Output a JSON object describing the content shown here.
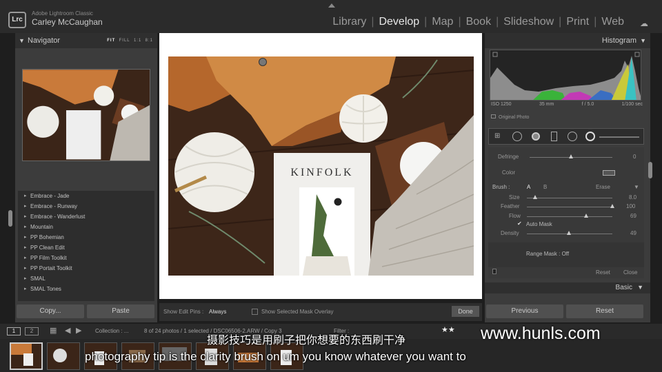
{
  "app": {
    "product": "Adobe Lightroom Classic",
    "user": "Carley McCaughan",
    "logo": "Lrc"
  },
  "modules": [
    "Library",
    "Develop",
    "Map",
    "Book",
    "Slideshow",
    "Print",
    "Web"
  ],
  "active_module": "Develop",
  "navigator": {
    "title": "Navigator",
    "options": [
      "FIT",
      "FILL",
      "1:1",
      "8:1"
    ],
    "selected": "FIT"
  },
  "presets": [
    "Embrace - Jade",
    "Embrace - Runway",
    "Embrace - Wanderlust",
    "Mountain",
    "PP Bohemian",
    "PP Clean Edit",
    "PP Film Toolkit",
    "PP Portait Toolkit",
    "SMAL",
    "SMAL Tones"
  ],
  "left_buttons": {
    "copy": "Copy...",
    "paste": "Paste"
  },
  "photo": {
    "magazine_title": "KINFOLK"
  },
  "toolbar": {
    "show_pins_label": "Show Edit Pins :",
    "show_pins_value": "Always",
    "overlay_label": "Show Selected Mask Overlay",
    "done": "Done"
  },
  "histogram": {
    "title": "Histogram",
    "iso": "ISO 1250",
    "focal": "35 mm",
    "aperture": "f / 5.0",
    "shutter": "1/100 sec",
    "original": "Original Photo"
  },
  "brush": {
    "defringe_label": "Defringe",
    "defringe_value": "0",
    "color_label": "Color",
    "brush_label": "Brush :",
    "brush_a": "A",
    "brush_b": "B",
    "erase": "Erase",
    "size_label": "Size",
    "size_value": "8.0",
    "feather_label": "Feather",
    "feather_value": "100",
    "flow_label": "Flow",
    "flow_value": "69",
    "automask_label": "Auto Mask",
    "density_label": "Density",
    "density_value": "49",
    "range_mask": "Range Mask : Off",
    "reset": "Reset",
    "close": "Close"
  },
  "sliders": {
    "defringe": 0.5,
    "size": 0.1,
    "feather": 1.0,
    "flow": 0.69,
    "density": 0.49
  },
  "basic_label": "Basic",
  "right_buttons": {
    "previous": "Previous",
    "reset": "Reset"
  },
  "filmbar": {
    "collection": "Collection : ...",
    "count": "8 of 24 photos / 1 selected / DSC06506-2.ARW / Copy 3",
    "filter": "Filter :"
  },
  "subtitles": {
    "chinese": "摄影技巧是用刷子把你想要的东西刷干净",
    "english": "photography tip is the clarity brush on um you know whatever you want to"
  },
  "watermark": "www.hunls.com",
  "colors": {
    "accent": "#e8e8e8",
    "panel": "#3c3c3c",
    "orange_velvet": "#c97a3a"
  }
}
